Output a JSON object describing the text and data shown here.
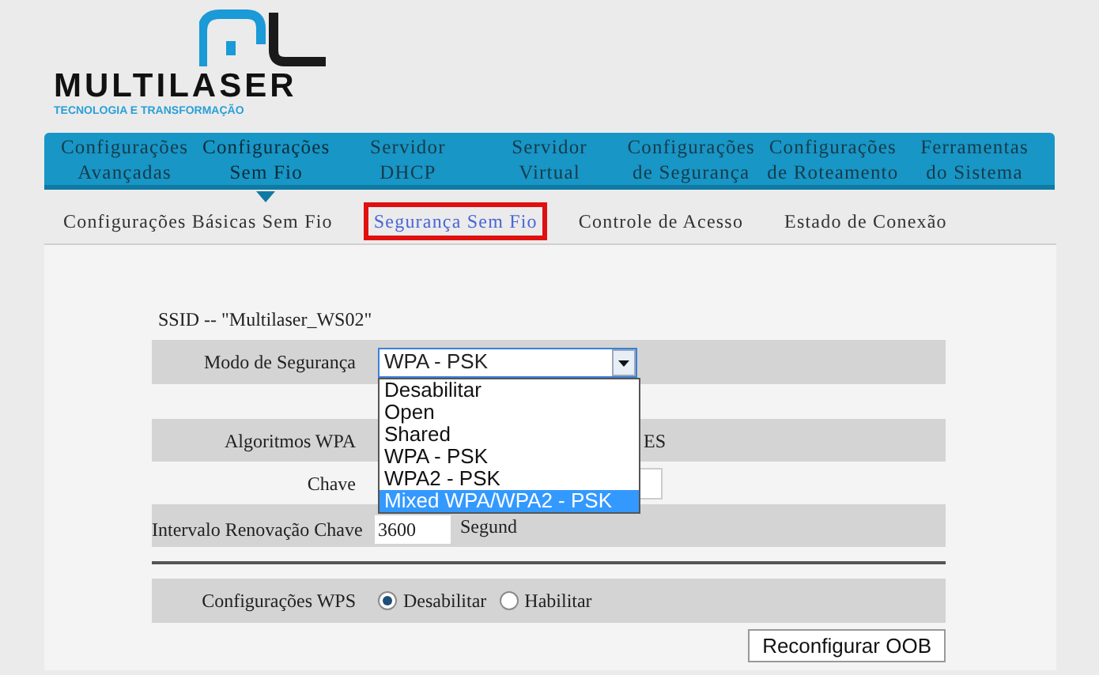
{
  "logo": {
    "name": "MULTILASER",
    "tagline": "TECNOLOGIA E TRANSFORMAÇÃO"
  },
  "nav": [
    {
      "lines": [
        "Configurações",
        "Avançadas"
      ],
      "selected": false
    },
    {
      "lines": [
        "Configurações",
        "Sem Fio"
      ],
      "selected": true
    },
    {
      "lines": [
        "Servidor",
        "DHCP"
      ],
      "selected": false
    },
    {
      "lines": [
        "Servidor",
        "Virtual"
      ],
      "selected": false
    },
    {
      "lines": [
        "Configurações",
        "de Segurança"
      ],
      "selected": false
    },
    {
      "lines": [
        "Configurações",
        "de Roteamento"
      ],
      "selected": false
    },
    {
      "lines": [
        "Ferramentas",
        "do Sistema"
      ],
      "selected": false
    }
  ],
  "subnav": [
    {
      "label": "Configurações Básicas Sem Fio",
      "selected": false
    },
    {
      "label": "Segurança Sem Fio",
      "selected": true
    },
    {
      "label": "Controle de Acesso",
      "selected": false
    },
    {
      "label": "Estado de Conexão",
      "selected": false
    }
  ],
  "ssid": "SSID -- \"Multilaser_WS02\"",
  "security_mode": {
    "label": "Modo de Segurança",
    "value": "WPA - PSK",
    "expanded": true,
    "options": [
      {
        "label": "Desabilitar",
        "highlighted": false
      },
      {
        "label": "Open",
        "highlighted": false
      },
      {
        "label": "Shared",
        "highlighted": false
      },
      {
        "label": "WPA - PSK",
        "highlighted": false
      },
      {
        "label": "WPA2 - PSK",
        "highlighted": false
      },
      {
        "label": "Mixed WPA/WPA2 - PSK",
        "highlighted": true
      }
    ]
  },
  "wpa_algorithms": {
    "label": "Algoritmos WPA",
    "value": "ES"
  },
  "key": {
    "label": "Chave"
  },
  "renewal": {
    "label": "Intervalo Renovação Chave",
    "value": "3600",
    "unit": "Segund"
  },
  "wps": {
    "label": "Configurações WPS",
    "options": [
      {
        "label": "Desabilitar",
        "selected": true
      },
      {
        "label": "Habilitar",
        "selected": false
      }
    ]
  },
  "button": "Reconfigurar OOB"
}
